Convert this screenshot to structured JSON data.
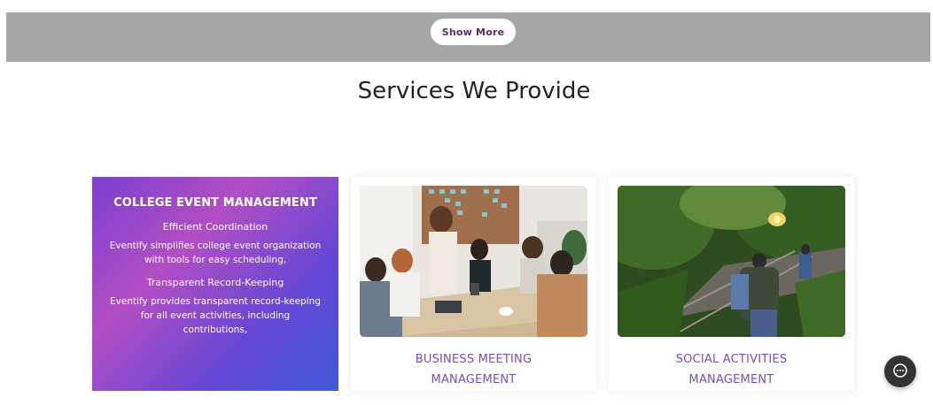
{
  "top_band": {
    "show_more_label": "Show More"
  },
  "services": {
    "title": "Services We Provide",
    "featured_card": {
      "heading": "COLLEGE EVENT MANAGEMENT",
      "items": [
        {
          "title": "Efficient Coordination",
          "text": "Eventify simplifies college event organization with tools for easy scheduling,"
        },
        {
          "title": "Transparent Record-Keeping",
          "text": "Eventify provides transparent record-keeping for all event activities, including contributions,"
        }
      ]
    },
    "cards": [
      {
        "caption_line1": "BUSINESS MEETING",
        "caption_line2": "MANAGEMENT",
        "image": "business-meeting-photo"
      },
      {
        "caption_line1": "SOCIAL ACTIVITIES",
        "caption_line2": "MANAGEMENT",
        "image": "railway-hikers-photo"
      }
    ]
  },
  "chat": {
    "icon": "chat-bubble-icon"
  },
  "colors": {
    "accent": "#7a4bc0",
    "band": "#a6a6a6",
    "gradient_start": "#b24ec4",
    "gradient_end": "#3f5ad8"
  }
}
